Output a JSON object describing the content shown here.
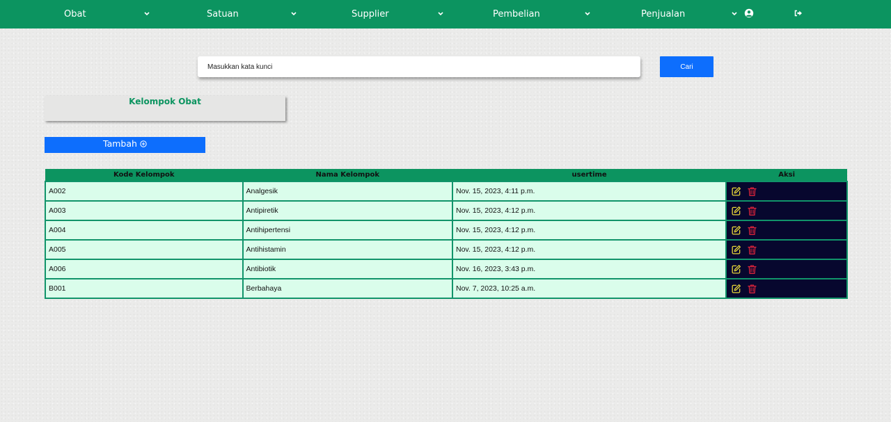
{
  "nav": {
    "items": [
      {
        "label": "Obat"
      },
      {
        "label": "Satuan"
      },
      {
        "label": "Supplier"
      },
      {
        "label": "Pembelian"
      },
      {
        "label": "Penjualan"
      }
    ],
    "user_icon": "user-circle-icon",
    "logout_icon": "sign-out-icon"
  },
  "search": {
    "placeholder": "Masukkan kata kunci",
    "button_label": "Cari"
  },
  "page": {
    "title": "Kelompok Obat",
    "add_label": "Tambah"
  },
  "table": {
    "headers": [
      "Kode Kelompok",
      "Nama Kelompok",
      "usertime",
      "Aksi"
    ],
    "rows": [
      {
        "kode": "A002",
        "nama": "Analgesik",
        "usertime": "Nov. 15, 2023, 4:11 p.m."
      },
      {
        "kode": "A003",
        "nama": "Antipiretik",
        "usertime": "Nov. 15, 2023, 4:12 p.m."
      },
      {
        "kode": "A004",
        "nama": "Antihipertensi",
        "usertime": "Nov. 15, 2023, 4:12 p.m."
      },
      {
        "kode": "A005",
        "nama": "Antihistamin",
        "usertime": "Nov. 15, 2023, 4:12 p.m."
      },
      {
        "kode": "A006",
        "nama": "Antibiotik",
        "usertime": "Nov. 16, 2023, 3:43 p.m."
      },
      {
        "kode": "B001",
        "nama": "Berbahaya",
        "usertime": "Nov. 7, 2023, 10:25 a.m."
      }
    ],
    "edit_icon": "edit-icon",
    "delete_icon": "trash-icon"
  },
  "colors": {
    "brand_green": "#0c9460",
    "primary_blue": "#0d6efd",
    "row_bg": "#dafdeb",
    "action_bg": "#07072e",
    "edit_yellow": "#e7d538",
    "delete_red": "#d8233a"
  }
}
